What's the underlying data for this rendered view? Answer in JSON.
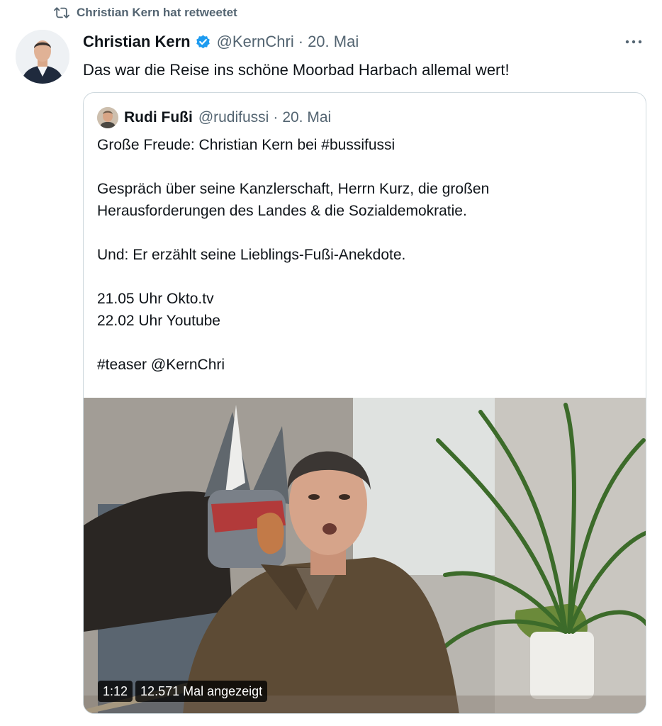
{
  "retweet": {
    "icon": "retweet-icon",
    "label": "Christian Kern hat retweetet"
  },
  "tweet": {
    "author": {
      "name": "Christian Kern",
      "handle": "@KernChri",
      "verified": true,
      "verified_color": "#1d9bf0",
      "avatar": "avatar"
    },
    "separator": "·",
    "date": "20. Mai",
    "more_icon": "more-icon",
    "text": "Das war die Reise ins schöne Moorbad Harbach allemal wert!"
  },
  "quote": {
    "author": {
      "name": "Rudi Fußi",
      "handle": "@rudifussi"
    },
    "separator": "·",
    "date": "20. Mai",
    "text": "Große Freude: Christian Kern bei #bussifussi\n\nGespräch über seine Kanzlerschaft, Herrn Kurz, die großen\nHerausforderungen des Landes & die Sozialdemokratie.\n\nUnd: Er erzählt seine Lieblings-Fußi-Anekdote.\n\n21.05 Uhr Okto.tv\n22.02 Uhr Youtube\n\n#teaser @KernChri",
    "video": {
      "duration": "1:12",
      "views": "12.571 Mal angezeigt"
    }
  },
  "colors": {
    "secondary_text": "#536471",
    "border": "#cfd9de",
    "link": "#1d9bf0"
  }
}
